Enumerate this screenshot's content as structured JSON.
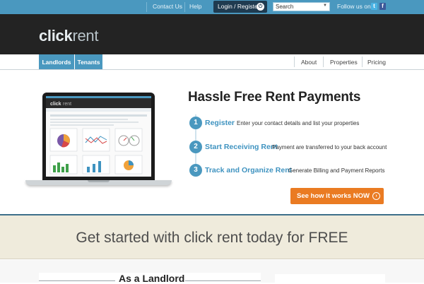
{
  "topbar": {
    "contact": "Contact Us",
    "help": "Help",
    "login": "Login / Register",
    "search_value": "Search",
    "follow": "Follow us on",
    "twitter_icon": "twitter-icon",
    "facebook_icon": "facebook-icon"
  },
  "brand": {
    "bold": "click",
    "light": "rent"
  },
  "nav": {
    "tabs": [
      "Landlords",
      "Tenants"
    ],
    "links": [
      "About",
      "Properties",
      "Pricing"
    ]
  },
  "screen": {
    "logo_bold": "click",
    "logo_light": "rent"
  },
  "hero": {
    "title": "Hassle Free Rent Payments",
    "steps": [
      {
        "num": "1",
        "title": "Register",
        "desc": "Enter your contact details and list your properties"
      },
      {
        "num": "2",
        "title": "Start Receiving Rent",
        "desc": "Payment are transferred to your back account"
      },
      {
        "num": "3",
        "title": "Track and Organize Rent",
        "desc": "Generate Billing and Payment Reports"
      }
    ],
    "cta": "See how it works NOW"
  },
  "banner": {
    "text": "Get started with click rent today for FREE"
  },
  "lower": {
    "landlord_title": "As a Landlord"
  },
  "colors": {
    "accent": "#4a98bf",
    "cta": "#ea7b22",
    "header": "#232323",
    "banner": "#efebdc"
  }
}
